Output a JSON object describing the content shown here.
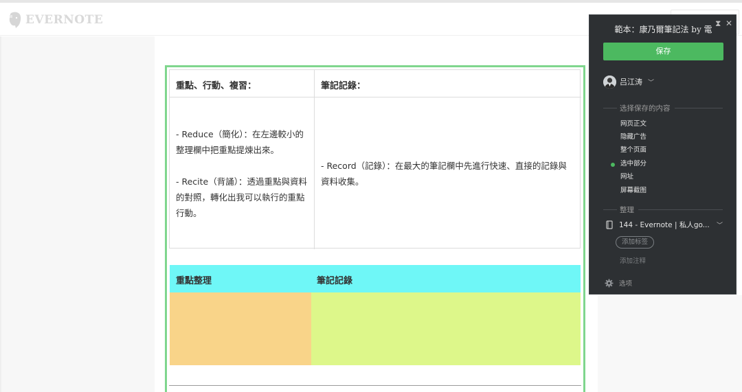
{
  "header": {
    "logo_text": "EVERNOTE"
  },
  "table1": {
    "col1_header": "重點、行動、複習：",
    "col2_header": "筆記記錄：",
    "col1_body": [
      "- Reduce（簡化）：在左邊較小的整理欄中把重點提煉出來。",
      "- Recite（背誦）：透過重點與資料的對照，轉化出我可以執行的重點行動。"
    ],
    "col2_body": "- Record（記錄）：在最大的筆記欄中先進行快速、直接的記錄與資料收集。"
  },
  "table2": {
    "col1_header": "重點整理",
    "col2_header": "筆記記錄",
    "colors": {
      "header_bg": "#6ff7f7",
      "col1_bg": "#f9d489",
      "col2_bg": "#ddf78a"
    }
  },
  "clipper": {
    "title": "範本：康乃爾筆記法 by 電",
    "save_label": "保存",
    "user_name": "吕江涛",
    "content_section_label": "选择保存的内容",
    "content_options": [
      "网页正文",
      "隐藏广告",
      "整个页面",
      "选中部分",
      "网址",
      "屏幕截图"
    ],
    "selected_option": "选中部分",
    "organize_section_label": "整理",
    "notebook": "144 - Evernote | 私人go...",
    "add_tag_label": "添加标签",
    "add_note_label": "添加注释",
    "options_label": "选项",
    "accent_color": "#4cb960"
  }
}
